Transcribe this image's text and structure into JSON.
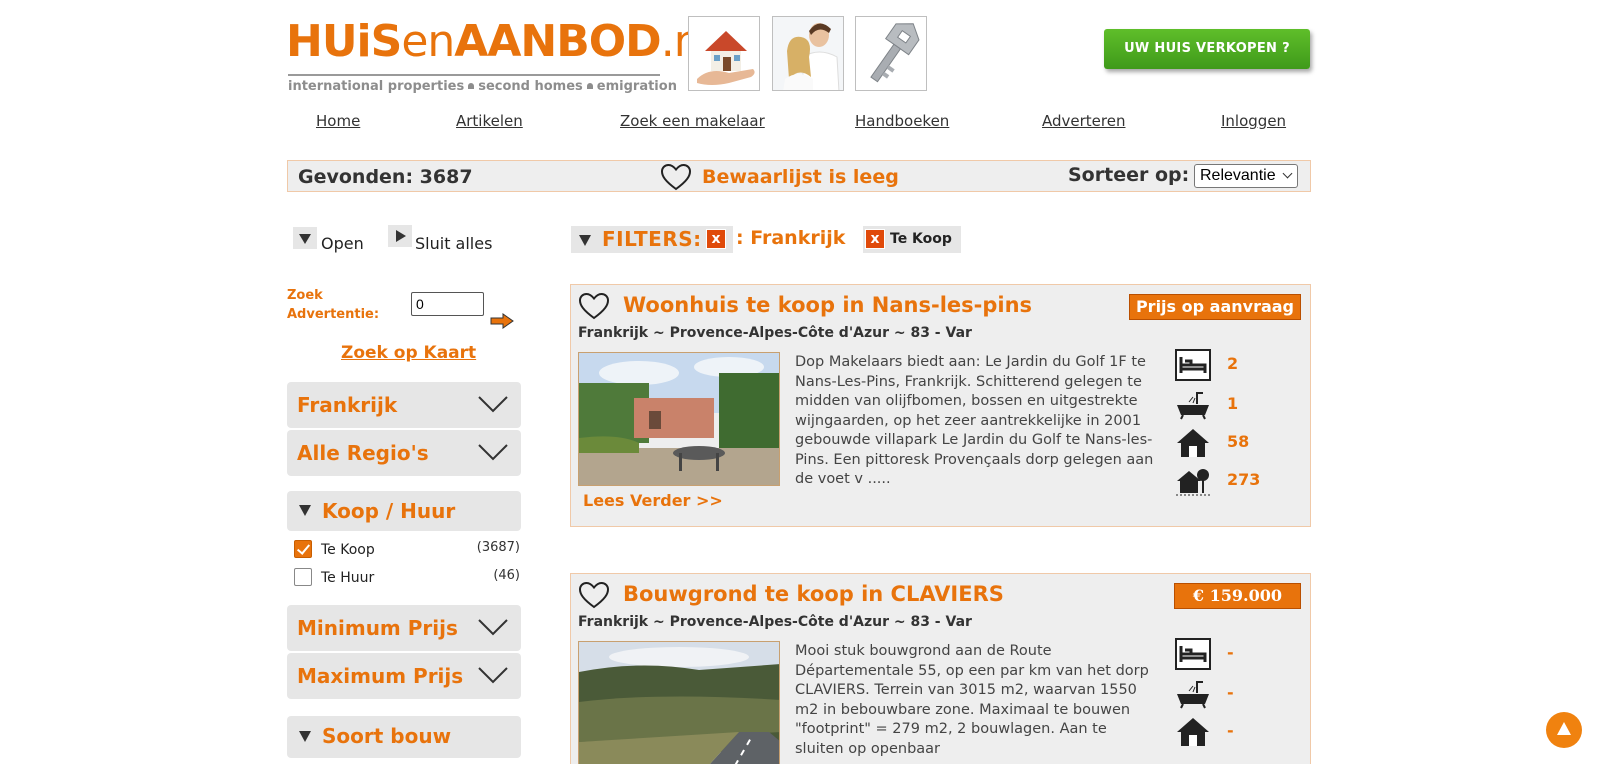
{
  "header": {
    "logo_part1": "HUiS",
    "logo_part2": "en",
    "logo_part3": "AANBOD",
    "logo_part4": ".nl",
    "tagline": [
      "international properties",
      "second homes",
      "emigration"
    ],
    "sell_button": "UW HUIS VERKOPEN ?"
  },
  "nav": [
    "Home",
    "Artikelen",
    "Zoek een makelaar",
    "Handboeken",
    "Adverteren",
    "Inloggen"
  ],
  "foundbar": {
    "found": "Gevonden: 3687",
    "favorites": "Bewaarlijst is leeg",
    "sort_label": "Sorteer op:",
    "sort_value": "Relevantie"
  },
  "sidebar": {
    "open_label": "Open",
    "close_label": "Sluit alles",
    "search_label_1": "Zoek",
    "search_label_2": "Advertentie:",
    "search_value": "0",
    "map_link": "Zoek op Kaart",
    "panels": [
      "Frankrijk",
      "Alle Regio's",
      "Koop / Huur",
      "Minimum Prijs",
      "Maximum Prijs",
      "Soort bouw"
    ],
    "options": [
      {
        "label": "Te Koop",
        "count": "(3687)",
        "checked": true
      },
      {
        "label": "Te Huur",
        "count": "(46)",
        "checked": false
      }
    ]
  },
  "filters": {
    "label": "FILTERS:",
    "remove": "x",
    "country": ": Frankrijk",
    "type": "Te Koop"
  },
  "listings": [
    {
      "title": "Woonhuis te koop in Nans-les-pins",
      "price": "Prijs op aanvraag",
      "location": "Frankrijk ~ Provence-Alpes-Côte d'Azur ~ 83 - Var",
      "description": "Dop Makelaars biedt aan: Le Jardin du Golf 1F te Nans-Les-Pins, Frankrijk. Schitterend gelegen te midden van olijfbomen, bossen en uitgestrekte wijngaarden, op het zeer aantrekkelijke in 2001 gebouwde villapark Le Jardin du Golf te Nans-les-Pins. Een pittoresk Provençaals dorp gelegen aan de voet v .....",
      "more": "Lees Verder >>",
      "bedrooms": "2",
      "bathrooms": "1",
      "living_area": "58",
      "plot_area": "273"
    },
    {
      "title": "Bouwgrond te koop in CLAVIERS",
      "price": "€ 159.000",
      "location": "Frankrijk ~ Provence-Alpes-Côte d'Azur ~ 83 - Var",
      "description": "Mooi stuk bouwgrond aan de Route Départementale 55, op een par km van het dorp CLAVIERS. Terrein van 3015 m2, waarvan 1550 m2 in bebouwbare zone. Maximaal te bouwen \"footprint\" = 279 m2, 2 bouwlagen. Aan te sluiten op openbaar",
      "bedrooms": "-",
      "bathrooms": "-",
      "living_area": "-"
    }
  ],
  "colors": {
    "accent": "#e8730c",
    "sell_green": "#4aa821",
    "panel_bg": "#e6e6e6"
  }
}
